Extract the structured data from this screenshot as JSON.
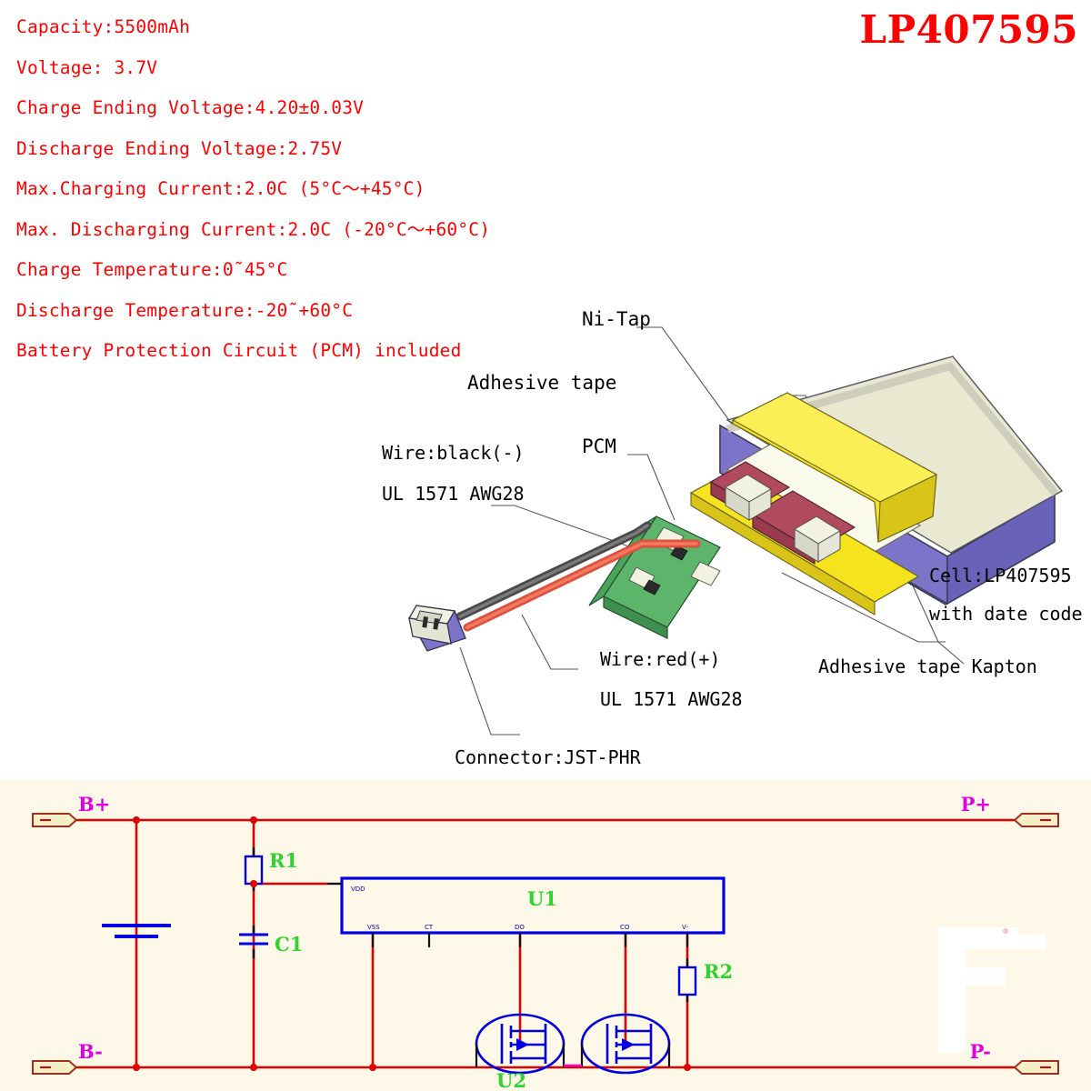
{
  "title": "LP407595",
  "specs": [
    "Capacity:5500mAh",
    "Voltage: 3.7V",
    "Charge Ending Voltage:4.20±0.03V",
    "Discharge Ending Voltage:2.75V",
    "Max.Charging Current:2.0C (5°C～+45°C)",
    "Max. Discharging Current:2.0C (-20°C～+60°C)",
    "Charge Temperature:0˜45°C",
    "Discharge Temperature:-20˜+60°C",
    "Battery Protection Circuit (PCM) included"
  ],
  "diagram": {
    "labels": {
      "ni_tap": "Ni-Tap",
      "adhesive_tape": "Adhesive tape",
      "pcm": "PCM",
      "wire_black_1": "Wire:black(-)",
      "wire_black_2": "UL 1571 AWG28",
      "wire_red_1": "Wire:red(+)",
      "wire_red_2": "UL 1571 AWG28",
      "connector": "Connector:JST-PHR",
      "cell_1": "Cell:LP407595",
      "cell_2": "with date code",
      "kapton": "Adhesive tape Kapton"
    }
  },
  "schematic": {
    "terminals": {
      "b_plus": "B+",
      "b_minus": "B-",
      "p_plus": "P+",
      "p_minus": "P-"
    },
    "components": {
      "r1": "R1",
      "r2": "R2",
      "c1": "C1",
      "u1": "U1",
      "u2": "U2"
    },
    "ic_pins": {
      "vdd": "VDD",
      "vss": "VSS",
      "ct": "CT",
      "do": "DO",
      "co": "CO",
      "vm": "V-"
    }
  },
  "colors": {
    "spec_text": "#FF0000",
    "title": "#FF0000",
    "label_text": "#000000",
    "schematic_bg": "#FDF8E7",
    "wire": "#E00000",
    "ic_border": "#0000E0",
    "designator": "#2FD22F",
    "net_label": "#E000E0",
    "cell_body": "#7B74C8",
    "cell_top": "#E9E9D2",
    "kapton_yellow": "#F5E31E",
    "pcb_green": "#5CB56B",
    "wire_red": "#E0503C",
    "wire_black": "#4A4A4A"
  }
}
